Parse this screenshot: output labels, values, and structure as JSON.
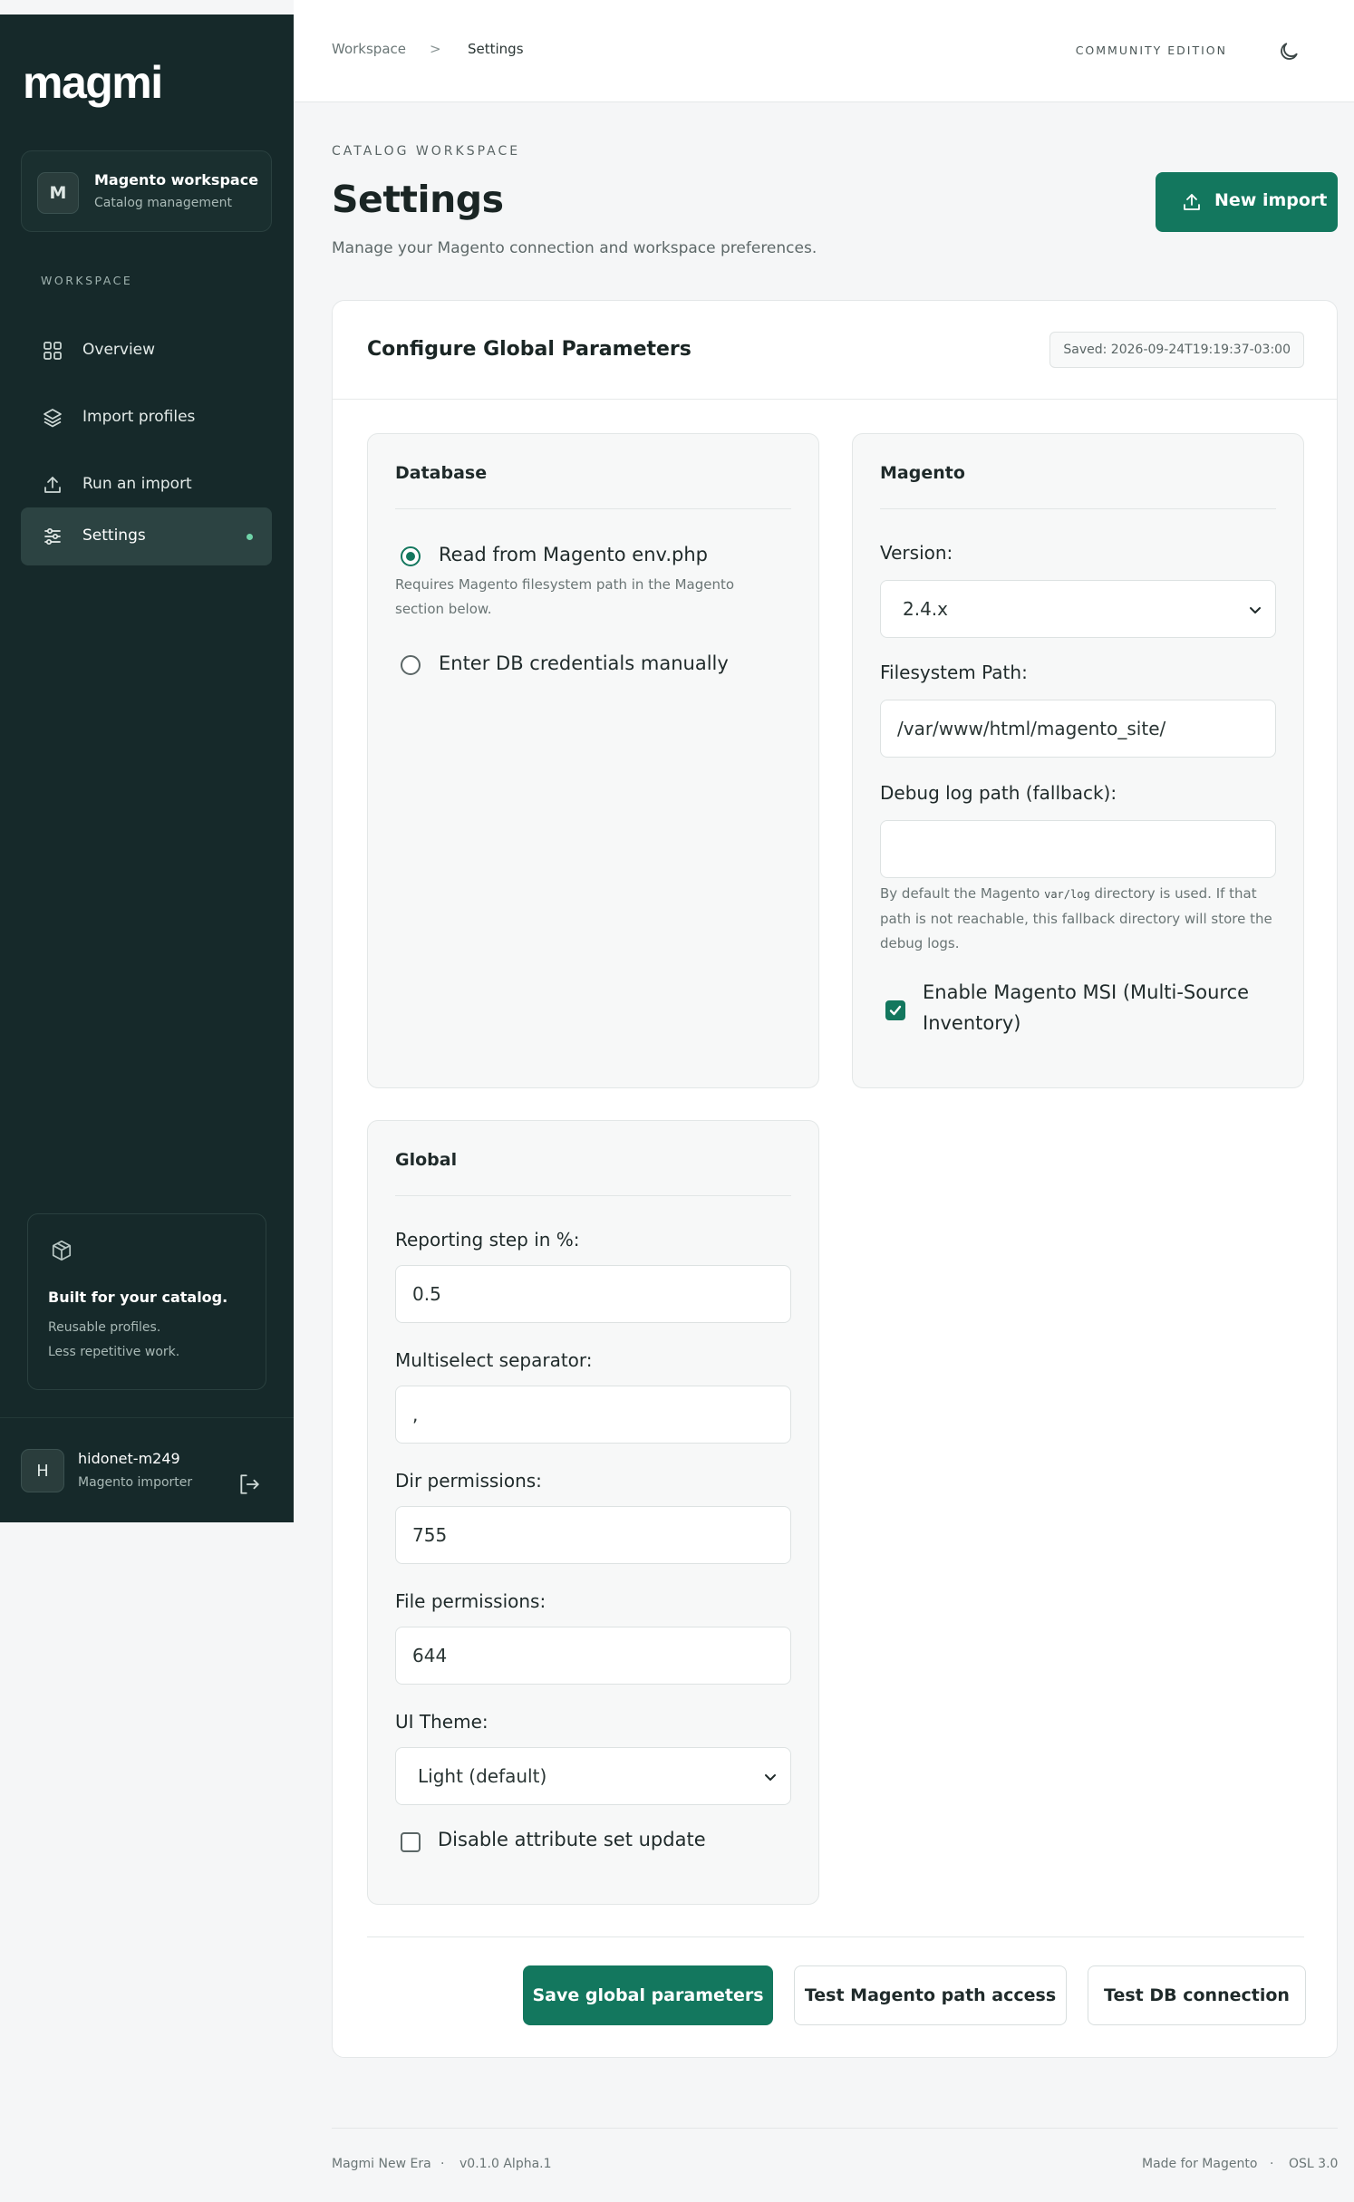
{
  "sidebar": {
    "logo": "magmi",
    "workspace": {
      "initial": "M",
      "name": "Magento workspace",
      "subtitle": "Catalog management"
    },
    "section_label": "WORKSPACE",
    "items": [
      {
        "label": "Overview",
        "icon": "grid-icon",
        "active": false
      },
      {
        "label": "Import profiles",
        "icon": "layers-icon",
        "active": false
      },
      {
        "label": "Run an import",
        "icon": "upload-icon",
        "active": false
      },
      {
        "label": "Settings",
        "icon": "sliders-icon",
        "active": true
      }
    ],
    "promo": {
      "icon": "box-icon",
      "title": "Built for your catalog.",
      "line1": "Reusable profiles.",
      "line2": "Less repetitive work."
    },
    "user": {
      "initial": "H",
      "name": "hidonet-m249",
      "role": "Magento importer",
      "logout_icon": "logout-icon"
    }
  },
  "topbar": {
    "breadcrumb": [
      "Workspace",
      "Settings"
    ],
    "breadcrumb_separator": ">",
    "edition": "COMMUNITY EDITION",
    "theme_icon": "moon-icon"
  },
  "header": {
    "eyebrow": "CATALOG WORKSPACE",
    "title": "Settings",
    "subtitle": "Manage your Magento connection and workspace preferences.",
    "new_import_label": "New import",
    "new_import_icon": "upload-icon"
  },
  "card": {
    "title": "Configure Global Parameters",
    "saved_badge": "Saved: 2026-09-24T19:19:37-03:00",
    "database": {
      "title": "Database",
      "option_env_label": "Read from Magento env.php",
      "option_env_selected": true,
      "option_env_help": "Requires Magento filesystem path in the Magento section below.",
      "option_manual_label": "Enter DB credentials manually",
      "option_manual_selected": false
    },
    "magento": {
      "title": "Magento",
      "version_label": "Version:",
      "version_value": "2.4.x",
      "path_label": "Filesystem Path:",
      "path_value": "/var/www/html/magento_site/",
      "debug_label": "Debug log path (fallback):",
      "debug_value": "",
      "debug_help_before": "By default the Magento",
      "debug_help_code": "var/log",
      "debug_help_after": "directory is used. If that path is not reachable, this fallback directory will store the debug logs.",
      "msi_label": "Enable Magento MSI (Multi-Source Inventory)",
      "msi_checked": true
    },
    "global": {
      "title": "Global",
      "step_label": "Reporting step in %:",
      "step_value": "0.5",
      "separator_label": "Multiselect separator:",
      "separator_value": ",",
      "dir_label": "Dir permissions:",
      "dir_value": "755",
      "file_label": "File permissions:",
      "file_value": "644",
      "theme_label": "UI Theme:",
      "theme_value": "Light (default)",
      "disable_attr_label": "Disable attribute set update",
      "disable_attr_checked": false
    },
    "actions": {
      "save": "Save global parameters",
      "test_path": "Test Magento path access",
      "test_db": "Test DB connection"
    }
  },
  "footer": {
    "app": "Magmi New Era",
    "dot": "·",
    "version": "v0.1.0 Alpha.1",
    "made_for": "Made for Magento",
    "license": "OSL 3.0"
  },
  "colors": {
    "accent": "#13775e",
    "sidebar_bg": "#16292a",
    "status_dot": "#6fd3a8"
  }
}
